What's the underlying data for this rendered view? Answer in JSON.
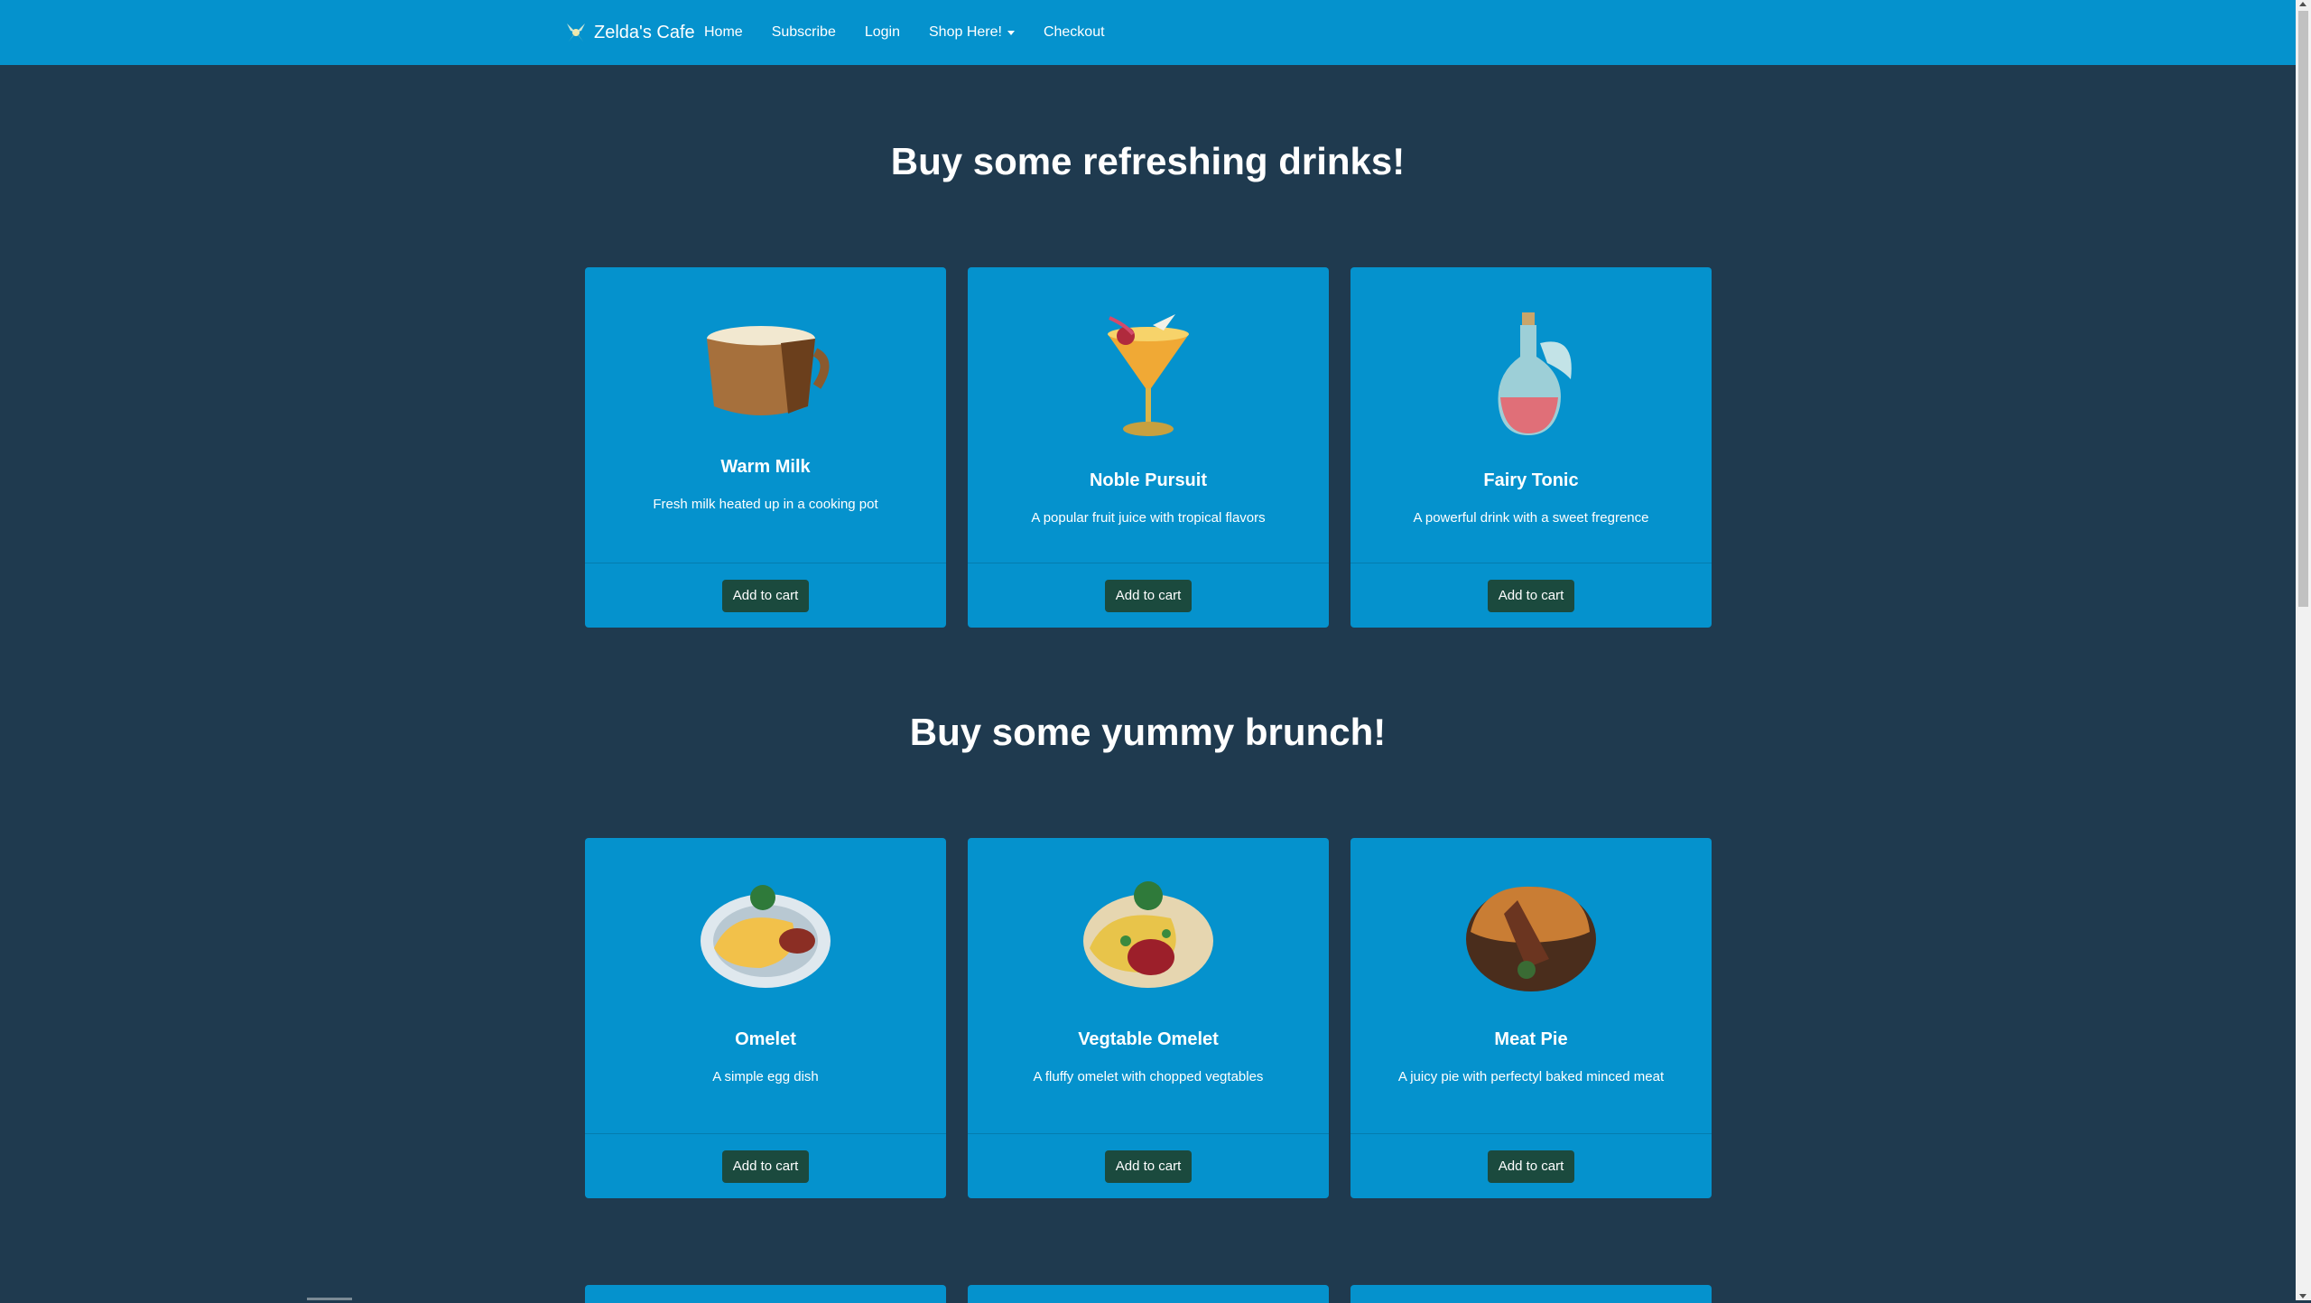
{
  "navbar": {
    "brand": "Zelda's Cafe",
    "links": [
      {
        "label": "Home"
      },
      {
        "label": "Subscribe"
      },
      {
        "label": "Login"
      },
      {
        "label": "Shop Here!"
      },
      {
        "label": "Checkout"
      }
    ]
  },
  "sections": [
    {
      "title": "Buy some refreshing drinks!",
      "items": [
        {
          "name": "Warm Milk",
          "description": "Fresh milk heated up in a cooking pot",
          "button": "Add to cart"
        },
        {
          "name": "Noble Pursuit",
          "description": "A popular fruit juice with tropical flavors",
          "button": "Add to cart"
        },
        {
          "name": "Fairy Tonic",
          "description": "A powerful drink with a sweet fregrence",
          "button": "Add to cart"
        }
      ]
    },
    {
      "title": "Buy some yummy brunch!",
      "items": [
        {
          "name": "Omelet",
          "description": "A simple egg dish",
          "button": "Add to cart"
        },
        {
          "name": "Vegtable Omelet",
          "description": "A fluffy omelet with chopped vegtables",
          "button": "Add to cart"
        },
        {
          "name": "Meat Pie",
          "description": "A juicy pie with perfectyl baked minced meat",
          "button": "Add to cart"
        }
      ]
    }
  ],
  "colors": {
    "navbar": "#0592cd",
    "background": "#1f3a4f",
    "card": "#0592cd",
    "button": "#1b4a3e"
  }
}
